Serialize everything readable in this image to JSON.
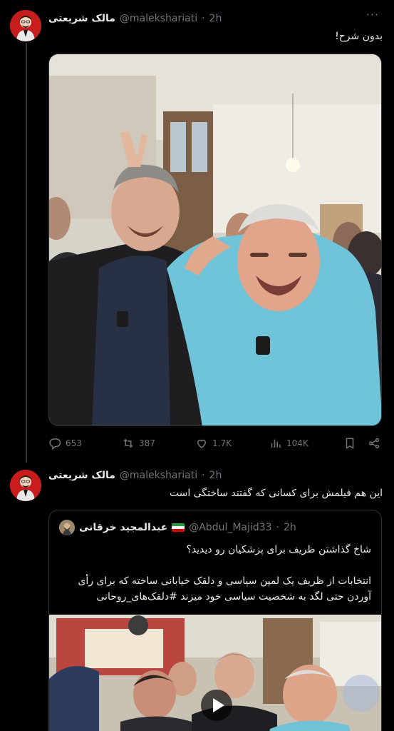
{
  "tweet1": {
    "author_name": "مالک شریعتی",
    "handle": "@malekshariati",
    "separator": "·",
    "time": "2h",
    "more": "···",
    "text": "بدون شرح!",
    "stats": {
      "replies": "653",
      "reposts": "387",
      "likes": "1.7K",
      "views": "104K"
    }
  },
  "tweet2": {
    "author_name": "مالک شریعتی",
    "handle": "@malekshariati",
    "separator": "·",
    "time": "2h",
    "text": "این هم فیلمش برای کسانی که گفتند ساختگی است",
    "quote": {
      "author_name": "عبدالمجید خرقانی",
      "handle": "@Abdul_Majid33",
      "separator": "·",
      "time": "2h",
      "line1": "شاخ گذاشتن ظریف برای پزشکیان رو دیدید؟",
      "line2": "انتخابات از ظریف یک لمپن سیاسی و دلقک خیابانی ساخته که برای رأی آوردن حتی لگد به شخصیت سیاسی خود میزند #دلقک‌های_روحانی"
    }
  },
  "icons": {
    "reply": "reply-icon",
    "repost": "repost-icon",
    "like": "heart-icon",
    "views": "views-icon",
    "bookmark": "bookmark-icon",
    "share": "share-icon",
    "play": "play-icon"
  },
  "colors": {
    "background": "#000000",
    "text": "#e7e9ea",
    "muted": "#71767b",
    "border": "#2f3336",
    "avatar_bg": "#c81d1d"
  }
}
